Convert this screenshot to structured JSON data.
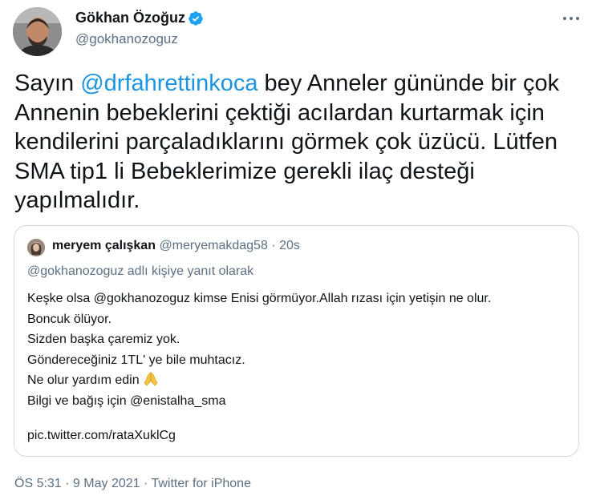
{
  "author": {
    "display_name": "Gökhan Özoğuz",
    "handle": "@gokhanozoguz",
    "verified_icon": "verified-badge-icon",
    "avatar_icon": "profile-photo"
  },
  "tweet_body": {
    "prefix": "Sayın ",
    "mention": "@drfahrettinkoca",
    "rest": " bey Anneler gününde bir çok Annenin bebeklerini çektiği acılardan kurtarmak için kendilerini parçaladıklarını görmek çok üzücü. Lütfen SMA tip1 li Bebeklerimize gerekli ilaç desteği yapılmalıdır."
  },
  "quoted_tweet": {
    "name": "meryem çalışkan",
    "handle": "@meryemakdag58",
    "separator": " · ",
    "time": "20s",
    "reply_to": "@gokhanozoguz adlı kişiye yanıt olarak",
    "lines": [
      "Keşke olsa @gokhanozoguz kimse Enisi görmüyor.Allah rızası için yetişin ne olur.",
      "Boncuk ölüyor.",
      "Sizden başka çaremiz yok.",
      "Göndereceğiniz 1TL' ye bile muhtacız.",
      "Ne olur yardım edin",
      "Bilgi ve bağış için @enistalha_sma"
    ],
    "emoji_icon": "praying-hands-icon",
    "link": "pic.twitter.com/rataXuklCg"
  },
  "footer": {
    "time": "ÖS 5:31",
    "separator": " · ",
    "date": "9 May 2021",
    "source": "Twitter for iPhone"
  },
  "colors": {
    "link_blue": "#1b95e0",
    "secondary_text": "#5b7083",
    "border": "#cfd9de",
    "verified_blue": "#1da1f2"
  }
}
